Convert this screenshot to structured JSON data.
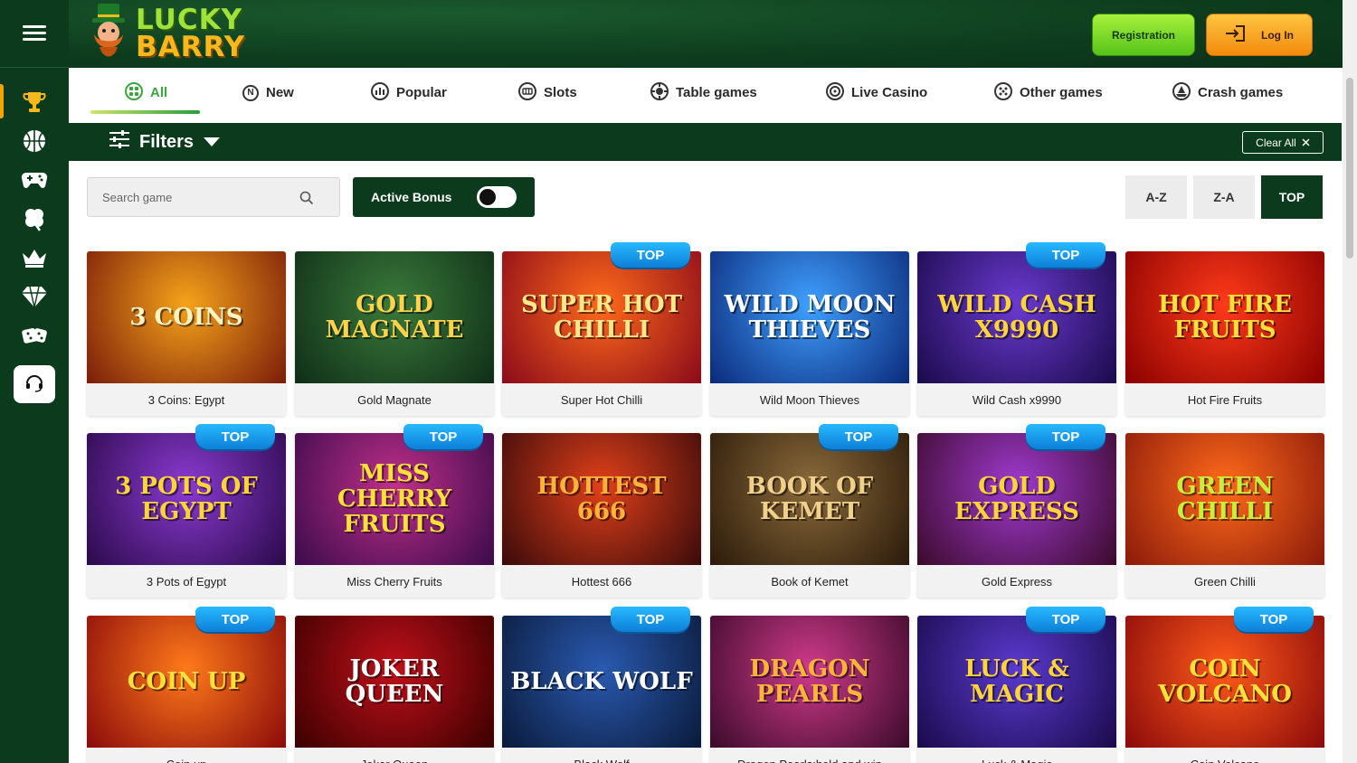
{
  "brand": {
    "line1": "LUCKY",
    "line2": "BARRY"
  },
  "header": {
    "register_label": "Registration",
    "login_label": "Log In"
  },
  "sidebar": {
    "items": [
      {
        "icon": "trophy-icon",
        "active": true
      },
      {
        "icon": "basketball-icon"
      },
      {
        "icon": "gamepad-icon"
      },
      {
        "icon": "clover-icon"
      },
      {
        "icon": "crown-icon"
      },
      {
        "icon": "diamond-icon"
      },
      {
        "icon": "dice-icon"
      }
    ],
    "support_icon": "headset-icon"
  },
  "tabs": [
    {
      "label": "All",
      "icon": "grid-icon",
      "active": true
    },
    {
      "label": "New",
      "icon": "new-icon"
    },
    {
      "label": "Popular",
      "icon": "popular-icon"
    },
    {
      "label": "Slots",
      "icon": "slots-icon"
    },
    {
      "label": "Table games",
      "icon": "table-games-icon"
    },
    {
      "label": "Live Casino",
      "icon": "live-casino-icon"
    },
    {
      "label": "Other games",
      "icon": "other-games-icon"
    },
    {
      "label": "Crash games",
      "icon": "crash-games-icon"
    }
  ],
  "filters": {
    "label": "Filters",
    "clear_label": "Clear All"
  },
  "search": {
    "placeholder": "Search game"
  },
  "bonus": {
    "label": "Active Bonus",
    "enabled": false
  },
  "sort": {
    "az": "A-Z",
    "za": "Z-A",
    "top": "TOP",
    "selected": "TOP"
  },
  "badge_label": "TOP",
  "games": [
    {
      "name": "3 Coins: Egypt",
      "art": "3 COINS",
      "top": false,
      "bg": [
        "#f5a31a",
        "#7a1c0a"
      ],
      "fg": "#fff3c0"
    },
    {
      "name": "Gold Magnate",
      "art": "GOLD MAGNATE",
      "top": false,
      "bg": [
        "#3a7a3a",
        "#0f2d18"
      ],
      "fg": "#ffd34a"
    },
    {
      "name": "Super Hot Chilli",
      "art": "SUPER HOT CHILLI",
      "top": true,
      "bg": [
        "#ff6a1a",
        "#8a0a1a"
      ],
      "fg": "#ffe88a"
    },
    {
      "name": "Wild Moon Thieves",
      "art": "WILD MOON THIEVES",
      "top": false,
      "bg": [
        "#3fa0ff",
        "#0b2a7a"
      ],
      "fg": "#ffffff"
    },
    {
      "name": "Wild Cash x9990",
      "art": "WILD CASH X9990",
      "top": true,
      "bg": [
        "#6a3ad0",
        "#1a0a4a"
      ],
      "fg": "#ffd33a"
    },
    {
      "name": "Hot Fire Fruits",
      "art": "HOT FIRE FRUITS",
      "top": false,
      "bg": [
        "#ff3a1a",
        "#8a0000"
      ],
      "fg": "#ffe03a"
    },
    {
      "name": "3 Pots of Egypt",
      "art": "3 POTS OF EGYPT",
      "top": true,
      "bg": [
        "#8a3ad0",
        "#2a0a4a"
      ],
      "fg": "#ffd33a"
    },
    {
      "name": "Miss Cherry Fruits",
      "art": "MISS CHERRY FRUITS",
      "top": true,
      "bg": [
        "#c0308a",
        "#3a0a4a"
      ],
      "fg": "#ffe03a"
    },
    {
      "name": "Hottest 666",
      "art": "HOTTEST 666",
      "top": false,
      "bg": [
        "#e0401a",
        "#3a0a0a"
      ],
      "fg": "#ffb33a"
    },
    {
      "name": "Book of Kemet",
      "art": "BOOK OF KEMET",
      "top": true,
      "bg": [
        "#8a6a3a",
        "#2a1a0a"
      ],
      "fg": "#f0d08a"
    },
    {
      "name": "Gold Express",
      "art": "GOLD EXPRESS",
      "top": true,
      "bg": [
        "#a03ad0",
        "#3a0a2a"
      ],
      "fg": "#ffd33a"
    },
    {
      "name": "Green Chilli",
      "art": "GREEN CHILLI",
      "top": false,
      "bg": [
        "#ff6a1a",
        "#8a1a0a"
      ],
      "fg": "#c8f03a"
    },
    {
      "name": "Coin up",
      "art": "COIN UP",
      "top": true,
      "bg": [
        "#ff7a1a",
        "#8a0a0a"
      ],
      "fg": "#ffe03a"
    },
    {
      "name": "Joker Queen",
      "art": "JOKER QUEEN",
      "top": false,
      "bg": [
        "#c0101a",
        "#3a0000"
      ],
      "fg": "#ffffff"
    },
    {
      "name": "Black Wolf",
      "art": "BLACK WOLF",
      "top": true,
      "bg": [
        "#2a5ab0",
        "#0a1a3a"
      ],
      "fg": "#ffffff"
    },
    {
      "name": "Dragon Pearls:hold and win",
      "art": "DRAGON PEARLS",
      "top": false,
      "bg": [
        "#d03a8a",
        "#3a0a2a"
      ],
      "fg": "#ffb33a"
    },
    {
      "name": "Luck & Magic",
      "art": "LUCK & MAGIC",
      "top": true,
      "bg": [
        "#5a3ad0",
        "#1a0a4a"
      ],
      "fg": "#ffd33a"
    },
    {
      "name": "Coin Volcano",
      "art": "COIN VOLCANO",
      "top": true,
      "bg": [
        "#ff5a1a",
        "#8a0a0a"
      ],
      "fg": "#ffe03a"
    }
  ]
}
